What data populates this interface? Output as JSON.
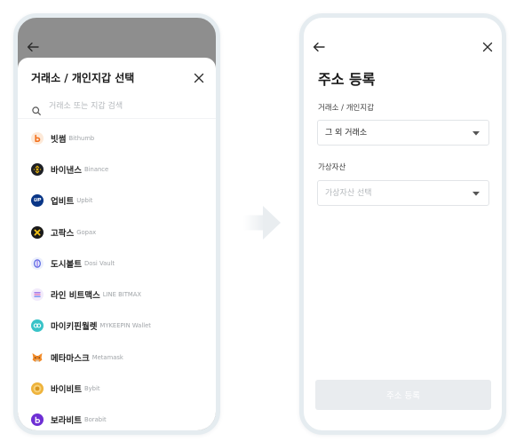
{
  "left_screen": {
    "back_icon": "back-arrow-icon",
    "overlay_color": "#8e8e8e",
    "sheet": {
      "title": "거래소 / 개인지갑 선택",
      "close_icon": "close-icon",
      "search": {
        "icon": "search-icon",
        "placeholder": "거래소 또는 지갑 검색"
      },
      "exchanges": [
        {
          "name": "빗썸",
          "name_en": "Bithumb",
          "icon": "bithumb-logo-icon",
          "color": "#f37321"
        },
        {
          "name": "바이낸스",
          "name_en": "Binance",
          "icon": "binance-logo-icon",
          "color": "#f0b90b"
        },
        {
          "name": "업비트",
          "name_en": "Upbit",
          "icon": "upbit-logo-icon",
          "logo_text": "UP",
          "color": "#093687"
        },
        {
          "name": "고팍스",
          "name_en": "Gopax",
          "icon": "gopax-logo-icon",
          "color": "#f6c416"
        },
        {
          "name": "도시볼트",
          "name_en": "Dosi Vault",
          "icon": "dosi-vault-logo-icon",
          "color": "#4f62e0"
        },
        {
          "name": "라인 비트맥스",
          "name_en": "LINE BITMAX",
          "icon": "line-bitmax-logo-icon",
          "color": "#9a6ee8"
        },
        {
          "name": "마이키핀월렛",
          "name_en": "MYKEEPIN Wallet",
          "icon": "mykeepin-logo-icon",
          "color": "#39c3c8"
        },
        {
          "name": "메타마스크",
          "name_en": "Metamask",
          "icon": "metamask-logo-icon",
          "color": "#f28c2a"
        },
        {
          "name": "바이비트",
          "name_en": "Bybit",
          "icon": "bybit-logo-icon",
          "color": "#eeb33c"
        },
        {
          "name": "보라비트",
          "name_en": "Borabit",
          "icon": "borabit-logo-icon",
          "color": "#6e2fd4"
        }
      ]
    }
  },
  "transition_icon": "right-arrow-icon",
  "right_screen": {
    "back_icon": "back-arrow-icon",
    "close_icon": "close-icon",
    "title": "주소 등록",
    "fields": [
      {
        "label": "거래소 / 개인지갑",
        "value": "그 외 거래소",
        "icon": "dropdown-caret-icon"
      },
      {
        "label": "가상자산",
        "placeholder": "가상자산 선택",
        "icon": "dropdown-caret-icon"
      }
    ],
    "submit": {
      "label": "주소 등록",
      "disabled": true
    }
  },
  "colors": {
    "frame_border": "#e5ecf0",
    "button_disabled_bg": "#e9ecef",
    "placeholder_text": "#b4b8bc",
    "transition_arrow": "#e9edf0"
  }
}
